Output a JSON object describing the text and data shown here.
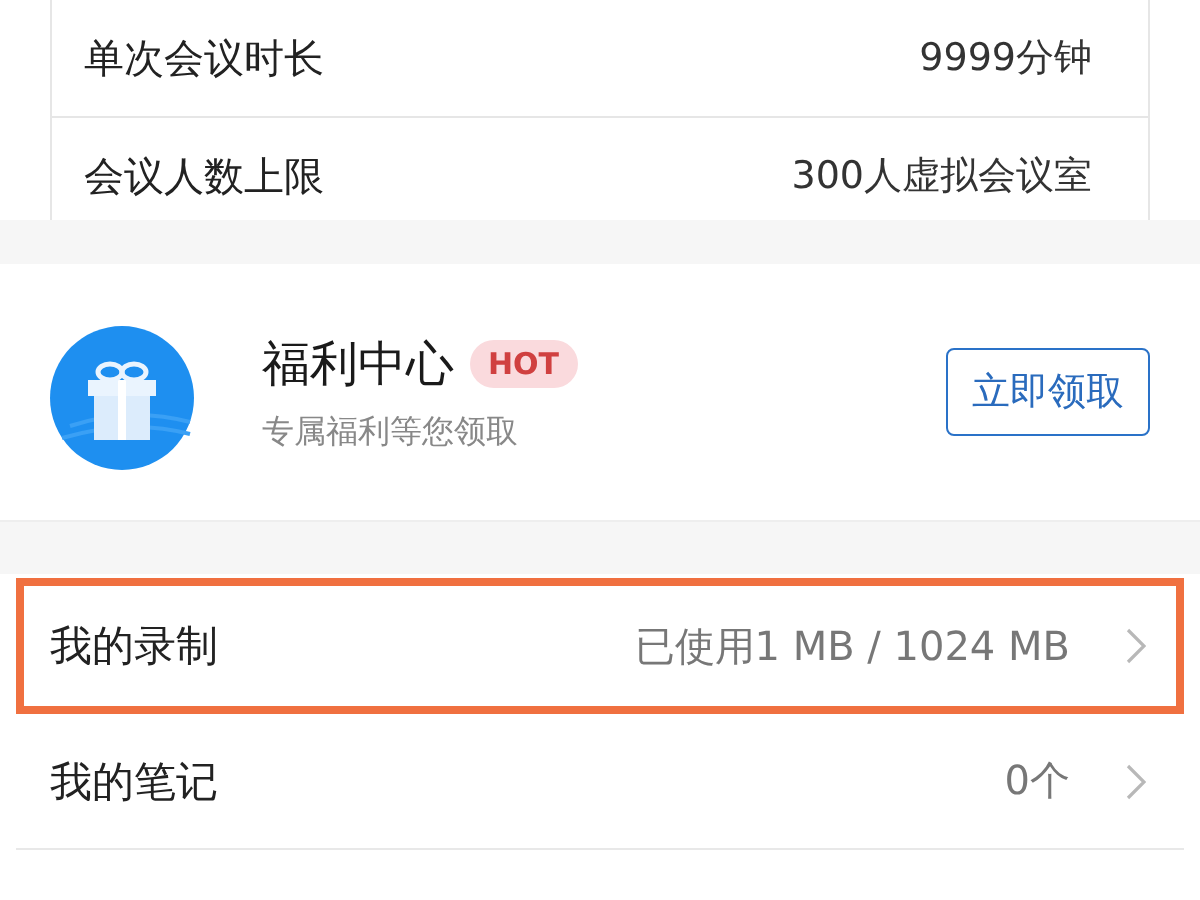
{
  "plan_table": {
    "rows": [
      {
        "label": "单次会议时长",
        "value": "9999分钟"
      },
      {
        "label": "会议人数上限",
        "value": "300人虚拟会议室"
      }
    ]
  },
  "welfare": {
    "title": "福利中心",
    "badge": "HOT",
    "subtitle": "专属福利等您领取",
    "button": "立即领取"
  },
  "menu": [
    {
      "label": "我的录制",
      "value": "已使用1 MB / 1024 MB",
      "highlighted": true
    },
    {
      "label": "我的笔记",
      "value": "0个",
      "highlighted": false
    }
  ]
}
